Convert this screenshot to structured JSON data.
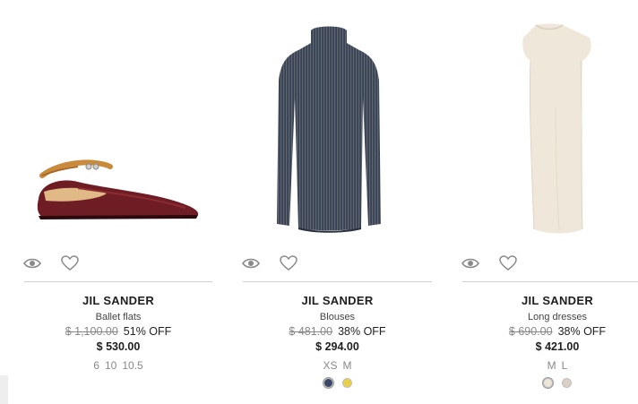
{
  "products": [
    {
      "brand": "JIL SANDER",
      "category": "Ballet flats",
      "old_price": "$ 1,100.00",
      "discount": "51% OFF",
      "price": "$ 530.00",
      "sizes": [
        "6",
        "10",
        "10.5"
      ],
      "swatches": []
    },
    {
      "brand": "JIL SANDER",
      "category": "Blouses",
      "old_price": "$ 481.00",
      "discount": "38% OFF",
      "price": "$ 294.00",
      "sizes": [
        "XS",
        "M"
      ],
      "swatches": [
        "#3a4766",
        "#e9cf45"
      ]
    },
    {
      "brand": "JIL SANDER",
      "category": "Long dresses",
      "old_price": "$ 690.00",
      "discount": "38% OFF",
      "price": "$ 421.00",
      "sizes": [
        "M",
        "L"
      ],
      "swatches": [
        "#ede6d8",
        "#d9cfc7"
      ]
    }
  ],
  "icons": {
    "quick_view": "eye-icon",
    "wishlist": "heart-icon"
  }
}
